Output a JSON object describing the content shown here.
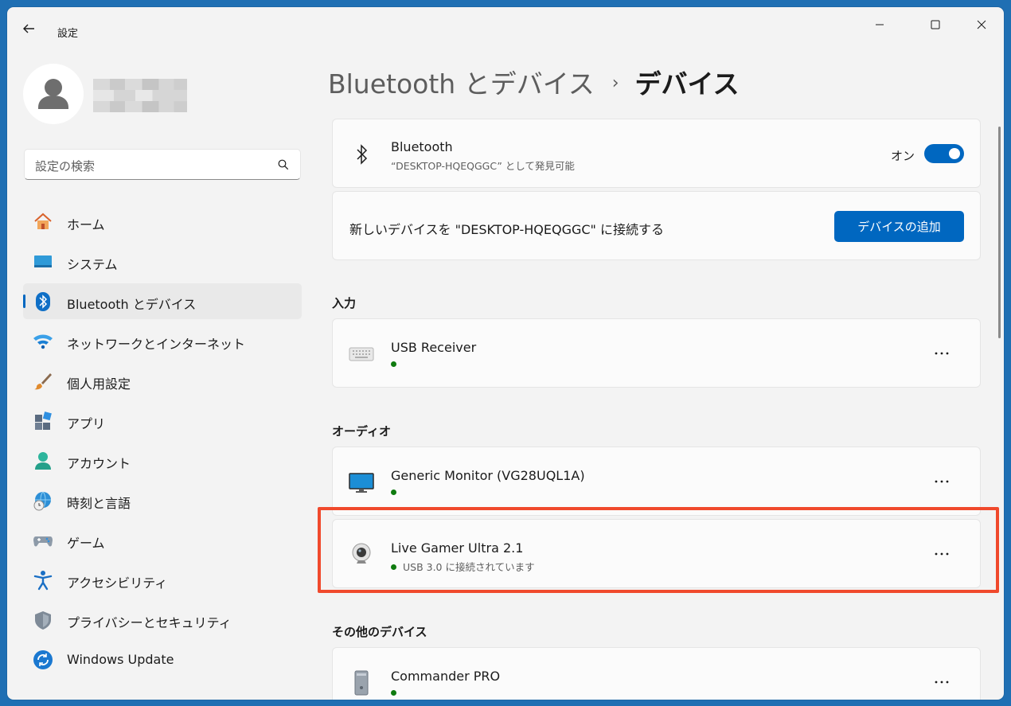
{
  "window": {
    "title": "設定"
  },
  "sidebar": {
    "search_placeholder": "設定の検索",
    "items": [
      {
        "label": "ホーム",
        "icon": "home-icon"
      },
      {
        "label": "システム",
        "icon": "monitor-icon"
      },
      {
        "label": "Bluetooth とデバイス",
        "icon": "bluetooth-icon",
        "active": true
      },
      {
        "label": "ネットワークとインターネット",
        "icon": "wifi-icon"
      },
      {
        "label": "個人用設定",
        "icon": "paintbrush-icon"
      },
      {
        "label": "アプリ",
        "icon": "apps-icon"
      },
      {
        "label": "アカウント",
        "icon": "person-icon"
      },
      {
        "label": "時刻と言語",
        "icon": "globe-clock-icon"
      },
      {
        "label": "ゲーム",
        "icon": "gamepad-icon"
      },
      {
        "label": "アクセシビリティ",
        "icon": "accessibility-icon"
      },
      {
        "label": "プライバシーとセキュリティ",
        "icon": "shield-icon"
      },
      {
        "label": "Windows Update",
        "icon": "update-icon"
      }
    ]
  },
  "breadcrumb": {
    "parent": "Bluetooth とデバイス",
    "separator": "›",
    "current": "デバイス"
  },
  "bluetooth_card": {
    "title": "Bluetooth",
    "subtitle": "“DESKTOP-HQEQGGC” として発見可能",
    "toggle_label": "オン",
    "toggle_on": true
  },
  "add_card": {
    "text": "新しいデバイスを \"DESKTOP-HQEQGGC\" に接続する",
    "button_label": "デバイスの追加"
  },
  "sections": {
    "input": "入力",
    "audio": "オーディオ",
    "other": "その他のデバイス"
  },
  "devices": {
    "usb_receiver": {
      "name": "USB Receiver",
      "status": ""
    },
    "generic_monitor": {
      "name": "Generic Monitor (VG28UQL1A)",
      "status": ""
    },
    "live_gamer": {
      "name": "Live Gamer Ultra 2.1",
      "status": "USB 3.0 に接続されています"
    },
    "commander_pro": {
      "name": "Commander PRO",
      "status": ""
    }
  },
  "colors": {
    "accent": "#0067c0",
    "connected_dot": "#0f7b0f",
    "highlight_border": "#f0492c"
  }
}
